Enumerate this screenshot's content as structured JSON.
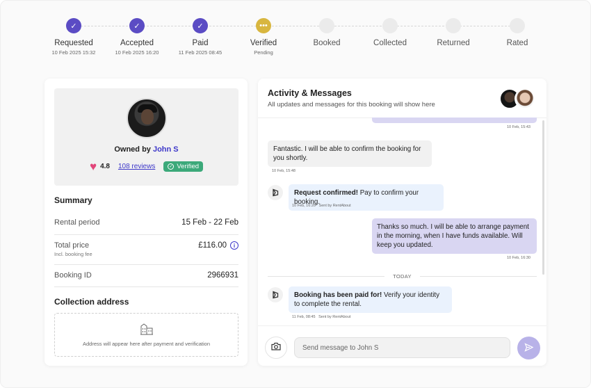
{
  "stepper": {
    "steps": [
      {
        "label": "Requested",
        "sub": "10 Feb 2025 15:32",
        "status": "done",
        "icon": "check-icon"
      },
      {
        "label": "Accepted",
        "sub": "10 Feb 2025 16:20",
        "status": "done",
        "icon": "check-icon"
      },
      {
        "label": "Paid",
        "sub": "11 Feb 2025 08:45",
        "status": "done",
        "icon": "check-icon"
      },
      {
        "label": "Verified",
        "sub": "Pending",
        "status": "pending",
        "icon": "ellipsis-icon"
      },
      {
        "label": "Booked",
        "sub": "",
        "status": "todo"
      },
      {
        "label": "Collected",
        "sub": "",
        "status": "todo"
      },
      {
        "label": "Returned",
        "sub": "",
        "status": "todo"
      },
      {
        "label": "Rated",
        "sub": "",
        "status": "todo"
      }
    ],
    "colors": {
      "done": "#5b4cc4",
      "pending": "#d8b63f",
      "todo": "#ebebeb"
    }
  },
  "owner": {
    "prefix": "Owned by",
    "name": "John S",
    "rating": "4.8",
    "reviews": "108 reviews",
    "verified": "Verified",
    "heart_color": "#e2467a"
  },
  "summary": {
    "title": "Summary",
    "rental_period_label": "Rental period",
    "rental_period_value": "15 Feb - 22 Feb",
    "total_price_label": "Total price",
    "total_price_sub": "Incl. booking fee",
    "total_price_value": "£116.00",
    "booking_id_label": "Booking ID",
    "booking_id_value": "2966931"
  },
  "collection": {
    "title": "Collection address",
    "placeholder": "Address will appear here after payment and verification"
  },
  "activity": {
    "title": "Activity & Messages",
    "subtitle": "All updates and messages for this booking will show here",
    "first_meta": "10 Feb, 15:43",
    "messages": [
      {
        "type": "peer",
        "text": "Fantastic. I will be able to confirm the booking for you shortly.",
        "meta": "10 Feb, 15:48"
      },
      {
        "type": "system",
        "bold": "Request confirmed!",
        "text": " Pay to confirm your booking.",
        "meta": "10 Feb, 16:20   Sent by RentAbout"
      },
      {
        "type": "self",
        "text": "Thanks so much. I will be able to arrange payment in the morning, when I have funds available. Will keep you updated.",
        "meta": "10 Feb, 16:30"
      },
      {
        "type": "system",
        "bold": "Booking has been paid for!",
        "text": " Verify your identity to complete the rental.",
        "meta": "11 Feb, 08:45   Sent by RentAbout"
      }
    ],
    "divider": "TODAY"
  },
  "composer": {
    "placeholder": "Send message to John S"
  },
  "colors": {
    "accent": "#3d37c9",
    "verified": "#3ca97a",
    "self_bubble": "#d9d6f2",
    "system_bubble": "#eaf2fd"
  }
}
